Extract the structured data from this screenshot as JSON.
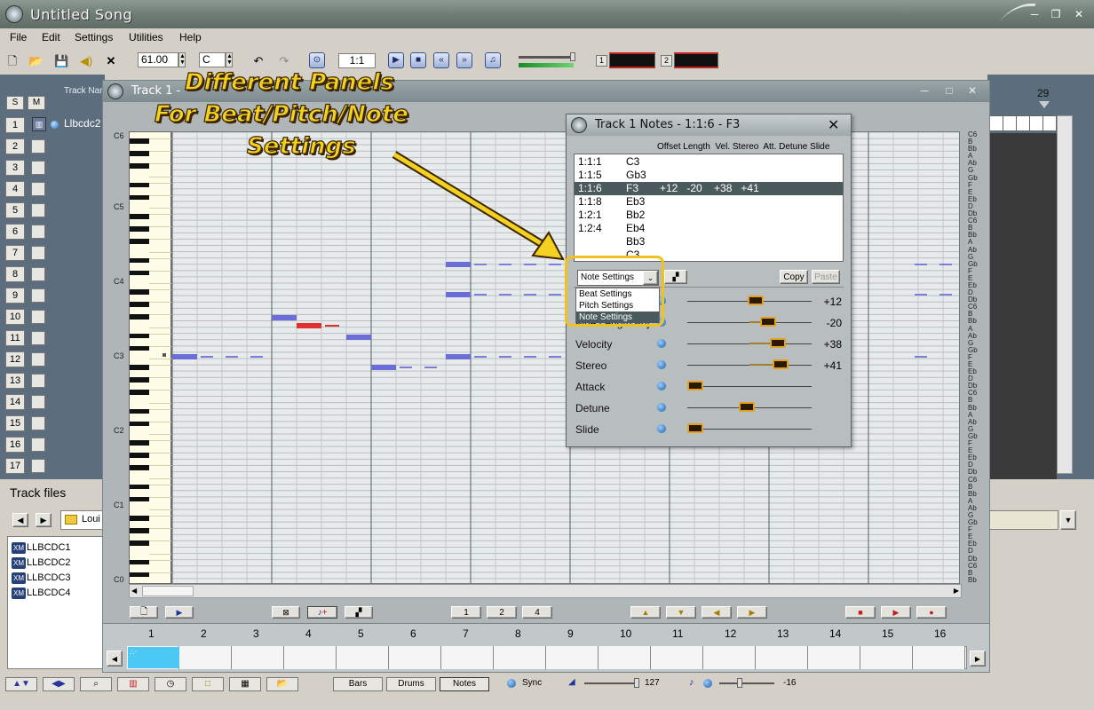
{
  "window": {
    "title": "Untitled Song"
  },
  "menu": [
    "File",
    "Edit",
    "Settings",
    "Utilities",
    "Help"
  ],
  "toolbar": {
    "tempo": "61.00",
    "key": "C",
    "position": "1:1",
    "meter1_label": "1",
    "meter2_label": "2"
  },
  "left_panel": {
    "s_label": "S",
    "m_label": "M",
    "track_name_header": "Track Nar",
    "track1_name": "Llbcdc2",
    "tracks": [
      "1",
      "2",
      "3",
      "4",
      "5",
      "6",
      "7",
      "8",
      "9",
      "10",
      "11",
      "12",
      "13",
      "14",
      "15",
      "16",
      "17"
    ]
  },
  "track_files": {
    "header": "Track files",
    "folder": "Loui",
    "files": [
      "LLBCDC1",
      "LLBCDC2",
      "LLBCDC3",
      "LLBCDC4"
    ]
  },
  "right_panel": {
    "bar_number": "29"
  },
  "track_window": {
    "title": "Track 1 -",
    "octaves": [
      "C6",
      "C5",
      "C4",
      "C3",
      "C2",
      "C1",
      "C0"
    ],
    "bottom_buttons": {
      "page1": "1",
      "page2": "2",
      "page4": "4"
    }
  },
  "notes_window": {
    "title": "Track 1 Notes - 1:1:6 -  F3",
    "columns_header": "Offset Length  Vel. Stereo  Att. Detune Slide",
    "rows": [
      {
        "pos": "1:1:1",
        "note": "C3",
        "vals": ""
      },
      {
        "pos": "1:1:5",
        "note": "Gb3",
        "vals": ""
      },
      {
        "pos": "1:1:6",
        "note": "F3",
        "vals": "+12   -20    +38   +41"
      },
      {
        "pos": "1:1:8",
        "note": "Eb3",
        "vals": ""
      },
      {
        "pos": "1:2:1",
        "note": "Bb2",
        "vals": ""
      },
      {
        "pos": "1:2:4",
        "note": "Eb4",
        "vals": ""
      },
      {
        "pos": "",
        "note": "Bb3",
        "vals": ""
      },
      {
        "pos": "",
        "note": "C3",
        "vals": ""
      }
    ],
    "dropdown_value": "Note Settings",
    "dropdown_options": [
      "Beat Settings",
      "Pitch Settings",
      "Note Settings"
    ],
    "copy_label": "Copy",
    "paste_label": "Paste",
    "sliders": [
      {
        "label": "",
        "value": "+12",
        "level": 0.55
      },
      {
        "label": "Fine Length Adj.",
        "value": "-20",
        "level": 0.65
      },
      {
        "label": "Velocity",
        "value": "+38",
        "level": 0.73
      },
      {
        "label": "Stereo",
        "value": "+41",
        "level": 0.75
      },
      {
        "label": "Attack",
        "value": "",
        "level": 0.0
      },
      {
        "label": "Detune",
        "value": "",
        "level": 0.48
      },
      {
        "label": "Slide",
        "value": "",
        "level": 0.0
      }
    ]
  },
  "annotation": {
    "line1": "Different Panels",
    "line2": "For Beat/Pitch/Note",
    "line3": "Settings"
  },
  "sequence": {
    "bars": [
      "1",
      "2",
      "3",
      "4",
      "5",
      "6",
      "7",
      "8",
      "9",
      "10",
      "11",
      "12",
      "13",
      "14",
      "15",
      "16"
    ]
  },
  "status_bar": {
    "bars_label": "Bars",
    "drums_label": "Drums",
    "notes_label": "Notes",
    "sync_label": "Sync",
    "volume_value": "127",
    "transpose_value": "-16"
  },
  "colors": {
    "note_blue": "#6a6ed6",
    "note_selected": "#e03030",
    "annotation": "#f4d020",
    "highlight": "#f1c21b"
  }
}
